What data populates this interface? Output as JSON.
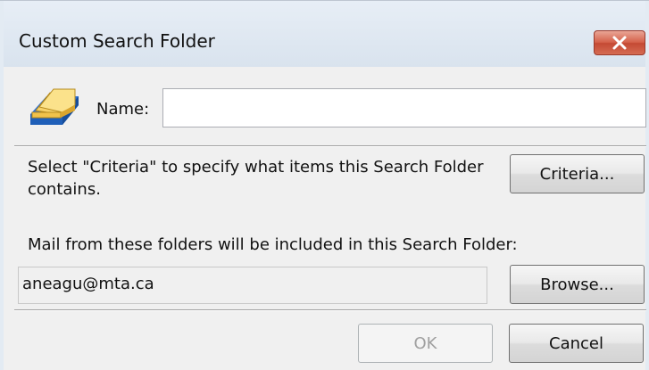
{
  "dialog": {
    "title": "Custom Search Folder",
    "close_icon": "close-icon"
  },
  "name_field": {
    "label": "Name:",
    "value": ""
  },
  "criteria": {
    "description": "Select \"Criteria\" to specify what items this Search Folder contains.",
    "button_label": "Criteria..."
  },
  "mail_folders": {
    "description": "Mail from these folders will be included in this Search Folder:",
    "value": "aneagu@mta.ca",
    "browse_label": "Browse..."
  },
  "footer": {
    "ok_label": "OK",
    "cancel_label": "Cancel"
  },
  "colors": {
    "close_button": "#d5614a",
    "title_bar": "#dfe7f0",
    "client_background": "#f0f0f0"
  }
}
